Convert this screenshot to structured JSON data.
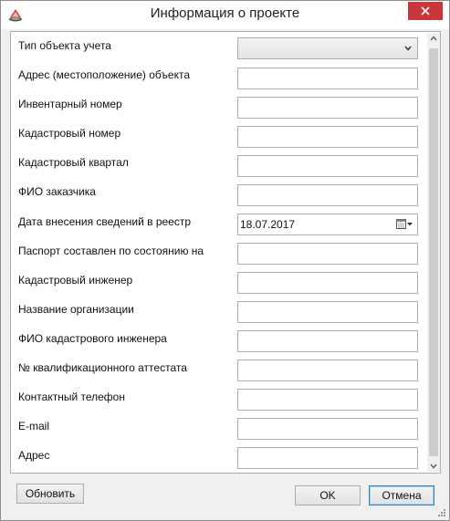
{
  "window": {
    "title": "Информация о проекте"
  },
  "form": {
    "fields": [
      {
        "label": "Тип объекта учета",
        "type": "select",
        "value": ""
      },
      {
        "label": "Адрес (местоположение) объекта",
        "type": "text",
        "value": ""
      },
      {
        "label": "Инвентарный номер",
        "type": "text",
        "value": ""
      },
      {
        "label": "Кадастровый номер",
        "type": "text",
        "value": ""
      },
      {
        "label": "Кадастровый квартал",
        "type": "text",
        "value": ""
      },
      {
        "label": "ФИО заказчика",
        "type": "text",
        "value": ""
      },
      {
        "label": "Дата внесения сведений в реестр",
        "type": "date",
        "value": "18.07.2017"
      },
      {
        "label": "Паспорт составлен по состоянию на",
        "type": "text",
        "value": ""
      },
      {
        "label": "Кадастровый инженер",
        "type": "text",
        "value": ""
      },
      {
        "label": "Название организации",
        "type": "text",
        "value": ""
      },
      {
        "label": "ФИО кадастрового инженера",
        "type": "text",
        "value": ""
      },
      {
        "label": "№ квалификационного аттестата",
        "type": "text",
        "value": ""
      },
      {
        "label": "Контактный телефон",
        "type": "text",
        "value": ""
      },
      {
        "label": "E-mail",
        "type": "text",
        "value": ""
      },
      {
        "label": "Адрес",
        "type": "text",
        "value": ""
      }
    ]
  },
  "buttons": {
    "refresh": "Обновить",
    "ok": "OK",
    "cancel": "Отмена"
  },
  "colors": {
    "close_button": "#c7373b",
    "default_button_border": "#3c7fb1",
    "dialog_background": "#f0f0f0"
  },
  "icons": {
    "app": "app-logo-icon",
    "close": "close-icon",
    "dropdown": "chevron-down-icon",
    "calendar": "calendar-icon",
    "scroll_up": "scroll-up-arrow-icon",
    "scroll_down": "scroll-down-arrow-icon",
    "resize": "resize-grip-icon"
  }
}
